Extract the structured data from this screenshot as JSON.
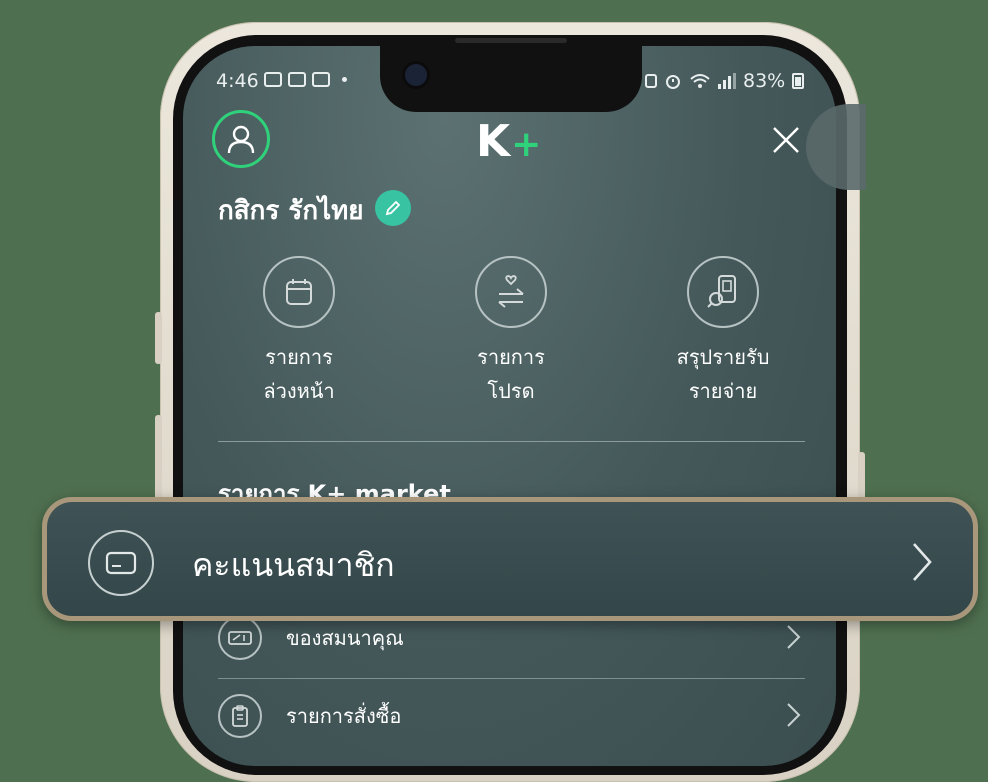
{
  "status_bar": {
    "time": "4:46",
    "battery": "83%"
  },
  "header": {
    "logo_text": "K",
    "logo_plus": "+"
  },
  "profile": {
    "name": "กสิกร รักไทย"
  },
  "shortcuts": [
    {
      "line1": "รายการ",
      "line2": "ล่วงหน้า"
    },
    {
      "line1": "รายการ",
      "line2": "โปรด"
    },
    {
      "line1": "สรุปรายรับ",
      "line2": "รายจ่าย"
    }
  ],
  "section": {
    "title": "รายการ K+ market"
  },
  "highlight_item": {
    "label": "คะแนนสมาชิก"
  },
  "menu_items": [
    {
      "label": "ของสมนาคุณ"
    },
    {
      "label": "รายการสั่งซื้อ"
    }
  ],
  "colors": {
    "accent_green": "#2fd27a",
    "edit_badge": "#38c4a3",
    "highlight_border": "#a8977a",
    "background": "#4f7050"
  }
}
